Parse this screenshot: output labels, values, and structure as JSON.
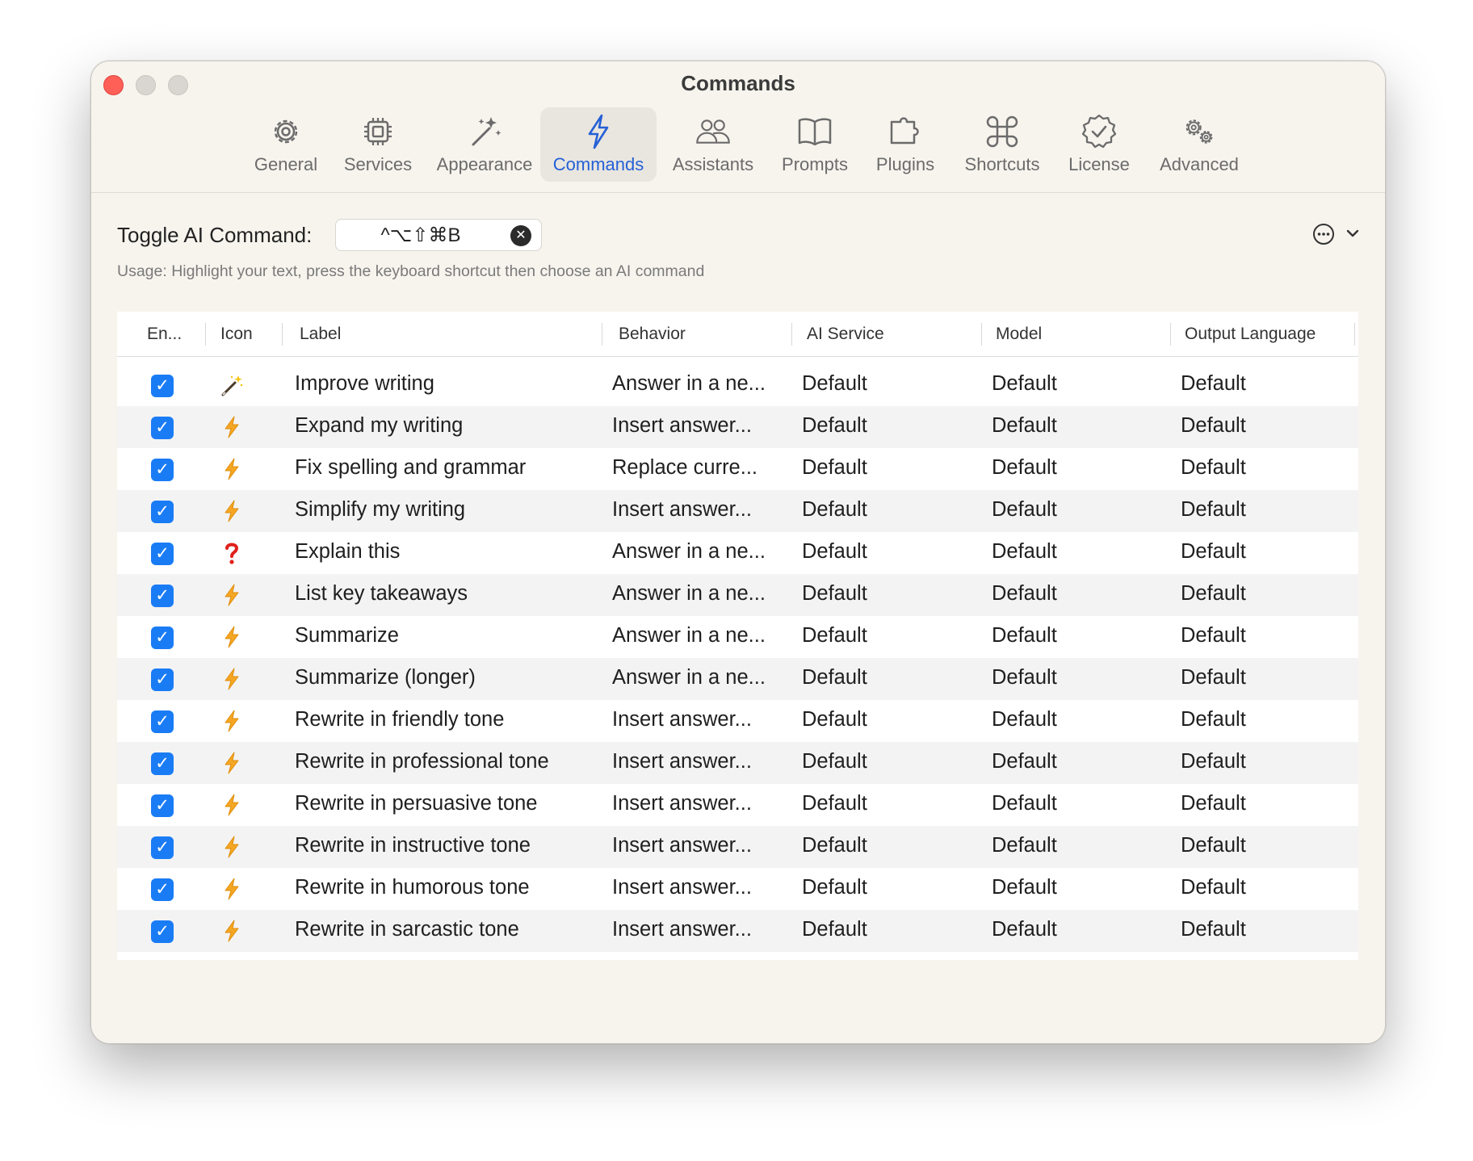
{
  "window": {
    "title": "Commands"
  },
  "toolbar": {
    "tabs": [
      {
        "label": "General",
        "icon": "gear-icon"
      },
      {
        "label": "Services",
        "icon": "cpu-icon"
      },
      {
        "label": "Appearance",
        "icon": "magic-wand-icon"
      },
      {
        "label": "Commands",
        "icon": "bolt-icon",
        "selected": true
      },
      {
        "label": "Assistants",
        "icon": "people-icon"
      },
      {
        "label": "Prompts",
        "icon": "book-icon"
      },
      {
        "label": "Plugins",
        "icon": "puzzle-icon"
      },
      {
        "label": "Shortcuts",
        "icon": "command-key-icon"
      },
      {
        "label": "License",
        "icon": "seal-check-icon"
      },
      {
        "label": "Advanced",
        "icon": "gears-icon"
      }
    ]
  },
  "settings": {
    "toggle_label": "Toggle AI Command:",
    "shortcut": "^⌥⇧⌘B",
    "usage": "Usage: Highlight your text, press the keyboard shortcut then choose an AI command"
  },
  "table": {
    "columns": [
      "En...",
      "Icon",
      "Label",
      "Behavior",
      "AI Service",
      "Model",
      "Output Language"
    ],
    "rows": [
      {
        "enabled": true,
        "icon": "magic-wand-icon",
        "label": "Improve writing",
        "behavior": "Answer in a ne...",
        "service": "Default",
        "model": "Default",
        "language": "Default"
      },
      {
        "enabled": true,
        "icon": "bolt-icon",
        "label": "Expand my writing",
        "behavior": "Insert answer...",
        "service": "Default",
        "model": "Default",
        "language": "Default"
      },
      {
        "enabled": true,
        "icon": "bolt-icon",
        "label": "Fix spelling and grammar",
        "behavior": "Replace curre...",
        "service": "Default",
        "model": "Default",
        "language": "Default"
      },
      {
        "enabled": true,
        "icon": "bolt-icon",
        "label": "Simplify my writing",
        "behavior": "Insert answer...",
        "service": "Default",
        "model": "Default",
        "language": "Default"
      },
      {
        "enabled": true,
        "icon": "question-mark-icon",
        "label": "Explain this",
        "behavior": "Answer in a ne...",
        "service": "Default",
        "model": "Default",
        "language": "Default"
      },
      {
        "enabled": true,
        "icon": "bolt-icon",
        "label": "List key takeaways",
        "behavior": "Answer in a ne...",
        "service": "Default",
        "model": "Default",
        "language": "Default"
      },
      {
        "enabled": true,
        "icon": "bolt-icon",
        "label": "Summarize",
        "behavior": "Answer in a ne...",
        "service": "Default",
        "model": "Default",
        "language": "Default"
      },
      {
        "enabled": true,
        "icon": "bolt-icon",
        "label": "Summarize (longer)",
        "behavior": "Answer in a ne...",
        "service": "Default",
        "model": "Default",
        "language": "Default"
      },
      {
        "enabled": true,
        "icon": "bolt-icon",
        "label": "Rewrite in friendly tone",
        "behavior": "Insert answer...",
        "service": "Default",
        "model": "Default",
        "language": "Default"
      },
      {
        "enabled": true,
        "icon": "bolt-icon",
        "label": "Rewrite in professional tone",
        "behavior": "Insert answer...",
        "service": "Default",
        "model": "Default",
        "language": "Default"
      },
      {
        "enabled": true,
        "icon": "bolt-icon",
        "label": "Rewrite in persuasive tone",
        "behavior": "Insert answer...",
        "service": "Default",
        "model": "Default",
        "language": "Default"
      },
      {
        "enabled": true,
        "icon": "bolt-icon",
        "label": "Rewrite in instructive tone",
        "behavior": "Insert answer...",
        "service": "Default",
        "model": "Default",
        "language": "Default"
      },
      {
        "enabled": true,
        "icon": "bolt-icon",
        "label": "Rewrite in humorous tone",
        "behavior": "Insert answer...",
        "service": "Default",
        "model": "Default",
        "language": "Default"
      },
      {
        "enabled": true,
        "icon": "bolt-icon",
        "label": "Rewrite in sarcastic tone",
        "behavior": "Insert answer...",
        "service": "Default",
        "model": "Default",
        "language": "Default"
      }
    ]
  },
  "footer": {
    "add_label": "+",
    "remove_label": "—",
    "help_label": "?"
  },
  "colors": {
    "accent": "#2560d6",
    "checkbox": "#1a7cf5",
    "bolt": "#f5a623",
    "close": "#fe5f57"
  }
}
